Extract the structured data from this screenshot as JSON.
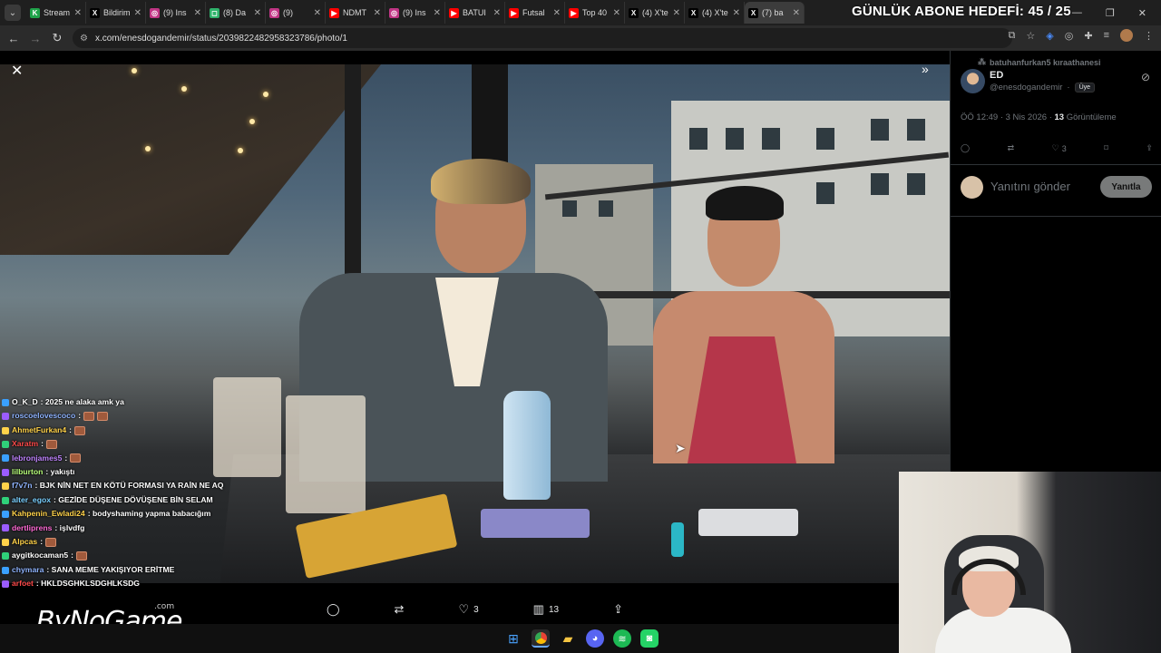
{
  "browser": {
    "tabs": [
      {
        "label": "Stream",
        "color": "#1fa34a",
        "glyph": "K"
      },
      {
        "label": "Bildirim",
        "color": "#000000",
        "glyph": "X"
      },
      {
        "label": "(9) Ins",
        "color": "#c13584",
        "glyph": "◎"
      },
      {
        "label": "(8) Da",
        "color": "#2fb36b",
        "glyph": "◻"
      },
      {
        "label": "(9)",
        "color": "#c13584",
        "glyph": "◎"
      },
      {
        "label": "NDMT",
        "color": "#ff0000",
        "glyph": "▶"
      },
      {
        "label": "(9) Ins",
        "color": "#c13584",
        "glyph": "◎"
      },
      {
        "label": "BATUI",
        "color": "#ff0000",
        "glyph": "▶"
      },
      {
        "label": "Futsal",
        "color": "#ff0000",
        "glyph": "▶"
      },
      {
        "label": "Top 40",
        "color": "#ff0000",
        "glyph": "▶"
      },
      {
        "label": "(4) X'te",
        "color": "#000000",
        "glyph": "X"
      },
      {
        "label": "(4) X'te",
        "color": "#000000",
        "glyph": "X"
      },
      {
        "label": "(7) ba",
        "color": "#000000",
        "glyph": "X",
        "active": true
      }
    ],
    "overlay_title": "GÜNLÜK ABONE HEDEFİ: 45 / 25",
    "url": "x.com/enesdogandemir/status/2039822482958323786/photo/1"
  },
  "chat": [
    {
      "user": "O_K_D",
      "color": "#ffffff",
      "msg": ": 2025 ne alaka amk ya",
      "emotes": 0
    },
    {
      "user": "roscoelovescoco",
      "color": "#8fb4ff",
      "msg": " :",
      "emotes": 2
    },
    {
      "user": "AhmetFurkan4",
      "color": "#ffd24a",
      "msg": " :",
      "emotes": 1
    },
    {
      "user": "Xaratm",
      "color": "#ff4a4a",
      "msg": " :",
      "emotes": 1
    },
    {
      "user": "lebronjames5",
      "color": "#c084ff",
      "msg": " :",
      "emotes": 1
    },
    {
      "user": "lilburton",
      "color": "#b7ff7a",
      "msg": " : yakıştı",
      "emotes": 0
    },
    {
      "user": "f7v7n",
      "color": "#8fb4ff",
      "msg": " : BJK NİN NET EN KÖTÜ FORMASI YA RAİN NE AQ",
      "emotes": 0
    },
    {
      "user": "alter_egox",
      "color": "#7ad0ff",
      "msg": " : GEZİDE DÜŞENE DÖVÜŞENE BİN SELAM",
      "emotes": 0
    },
    {
      "user": "Kahpenin_Ewladi24",
      "color": "#ffd24a",
      "msg": " : bodyshaming yapma babacığım",
      "emotes": 0
    },
    {
      "user": "dertliprens",
      "color": "#ff6ad5",
      "msg": " : işlvdfg",
      "emotes": 0
    },
    {
      "user": "Alpcas",
      "color": "#ffd24a",
      "msg": " :",
      "emotes": 1
    },
    {
      "user": "aygitkocaman5",
      "color": "#ffffff",
      "msg": " :",
      "emotes": 1
    },
    {
      "user": "chymara",
      "color": "#8fb4ff",
      "msg": " : SANA MEME YAKIŞIYOR ERİTME",
      "emotes": 0
    },
    {
      "user": "arfoet",
      "color": "#ff4a4a",
      "msg": " : HKLDSGHKLSDGHLKSDG",
      "emotes": 0
    }
  ],
  "viewer_actions": {
    "likes": "3",
    "views": "13"
  },
  "watermark": {
    "text": "ByNoGame",
    "suffix": ".com"
  },
  "post": {
    "repost_by": "batuhanfurkan5 kıraathanesi",
    "name": "ED",
    "handle": "@enesdogandemir",
    "badge": "Üye",
    "time": "ÖÖ 12:49 · 3 Nis 2026 · ",
    "views_count": "13",
    "views_label": " Görüntüleme",
    "likes": "3",
    "reply_placeholder": "Yanıtını gönder",
    "reply_button": "Yanıtla"
  }
}
